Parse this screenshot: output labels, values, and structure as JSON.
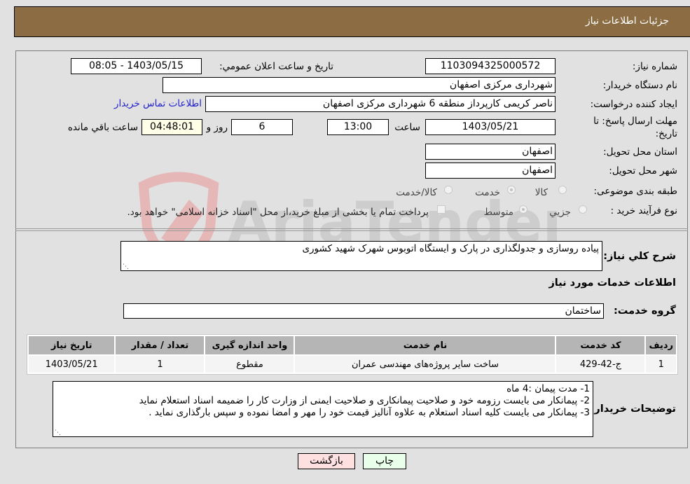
{
  "header": {
    "title": "جزئیات اطلاعات نیاز"
  },
  "form": {
    "need_number": {
      "label": "شماره نیاز:",
      "value": "1103094325000572"
    },
    "announce_datetime": {
      "label": "تاریخ و ساعت اعلان عمومي:",
      "value": "1403/05/15 - 08:05"
    },
    "buyer_org": {
      "label": "نام دستگاه خریدار:",
      "value": "شهرداری مرکزی اصفهان"
    },
    "requester": {
      "label": "ایجاد کننده درخواست:",
      "value": "ناصر کریمی کارپرداز منطقه 6 شهرداری مرکزی اصفهان",
      "contact_link": "اطلاعات تماس خریدار"
    },
    "deadline": {
      "label": "مهلت ارسال پاسخ: تا تاریخ:",
      "date": "1403/05/21",
      "time_label": "ساعت",
      "time": "13:00",
      "days": "6",
      "days_label": "روز و",
      "remaining": "04:48:01",
      "remaining_label": "ساعت باقي مانده"
    },
    "province": {
      "label": "استان محل تحویل:",
      "value": "اصفهان"
    },
    "city": {
      "label": "شهر محل تحویل:",
      "value": "اصفهان"
    },
    "category": {
      "label": "طبقه بندی موضوعی:",
      "options": [
        {
          "label": "کالا",
          "selected": false
        },
        {
          "label": "خدمت",
          "selected": true
        },
        {
          "label": "کالا/خدمت",
          "selected": false
        }
      ]
    },
    "purchase_type": {
      "label": "نوع فرآیند خرید :",
      "options": [
        {
          "label": "جزيي",
          "selected": false
        },
        {
          "label": "متوسط",
          "selected": true
        }
      ],
      "treasury_note": "پرداخت تمام یا بخشی از مبلغ خرید،از محل \"اسناد خزانه اسلامی\" خواهد بود.",
      "treasury_checked": false
    },
    "description": {
      "label": "شرح کلي نیاز:",
      "value": "پیاده روسازی و جدولگذاری در پارک و ایستگاه اتوبوس شهرک شهید کشوری"
    }
  },
  "services": {
    "section_title": "اطلاعات خدمات مورد نیاز",
    "group": {
      "label": "گروه خدمت:",
      "value": "ساختمان"
    },
    "table": {
      "columns": [
        "ردیف",
        "کد خدمت",
        "نام خدمت",
        "واحد اندازه گیری",
        "تعداد / مقدار",
        "تاریخ نیاز"
      ],
      "rows": [
        [
          "1",
          "ج-42-429",
          "ساخت سایر پروژه‌های مهندسی عمران",
          "مقطوع",
          "1",
          "1403/05/21"
        ]
      ]
    }
  },
  "buyer_notes": {
    "label": "توضیحات خریدار:",
    "lines": [
      "1- مدت پیمان :4 ماه",
      "2- پیمانکار می بایست رزومه خود و صلاحیت پیمانکاری و صلاحیت ایمنی از وزارت کار را ضمیمه اسناد استعلام نماید",
      "3- پیمانکار می بایست کلیه اسناد استعلام به علاوه آنالیز قیمت خود را مهر و امضا نموده و سپس بارگذاری نماید ."
    ]
  },
  "buttons": {
    "print": "چاپ",
    "back": "بازگشت"
  },
  "watermark": {
    "text": "AriaTender.neT"
  },
  "colors": {
    "header_bg": "#8c6d43",
    "link": "#2222cc",
    "back_btn": "#ffe0e0",
    "print_btn": "#eaffea",
    "remaining_bg": "#ffffe8"
  }
}
